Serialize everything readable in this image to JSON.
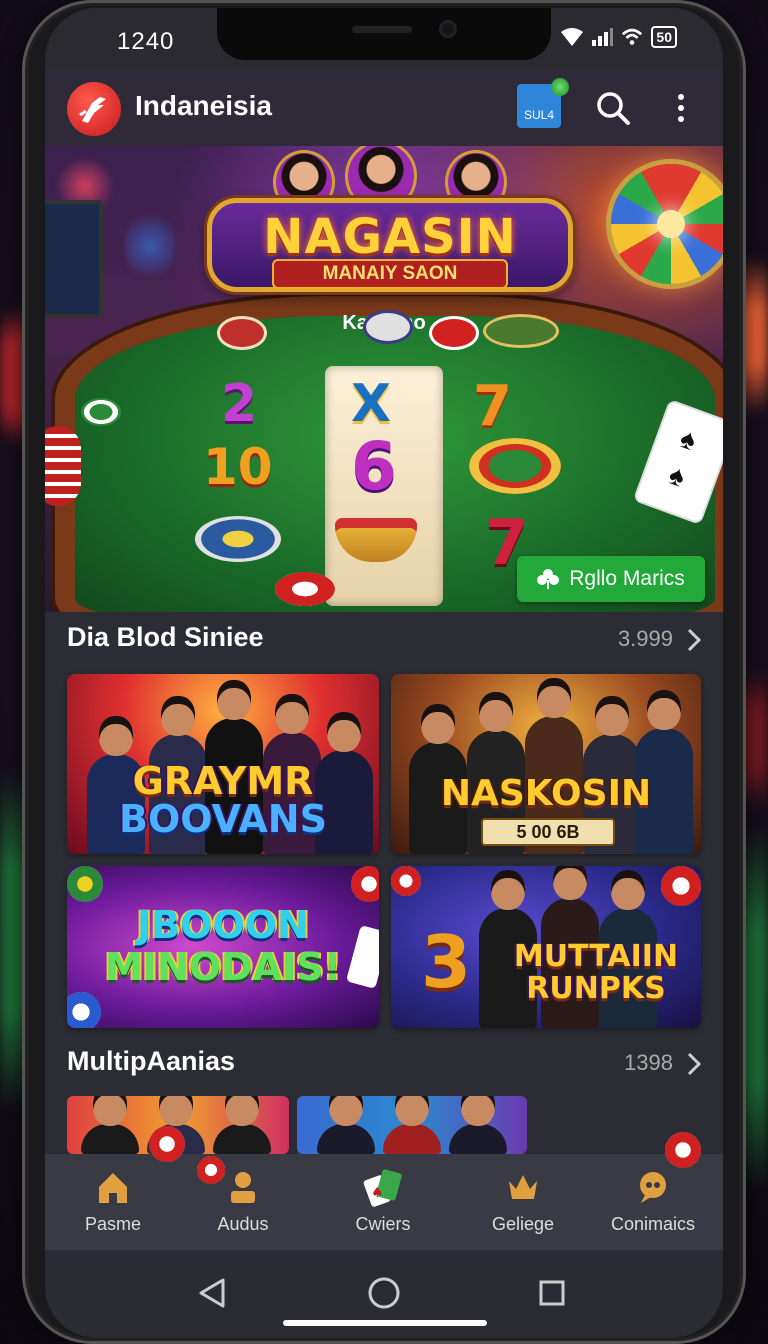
{
  "status_bar": {
    "time": "1240",
    "battery": "50"
  },
  "app_bar": {
    "title": "Indaneisia",
    "mini_game_label": "SUL4"
  },
  "hero": {
    "marquee_title": "NAGASIN",
    "marquee_subtitle": "MANAIY SAON",
    "table_label": "Ka.ssino",
    "reel_symbols": [
      "2",
      "X",
      "7",
      "10",
      "6",
      "7"
    ],
    "cta_label": "Rgllo Marics"
  },
  "section1": {
    "title": "Dia Blod Siniee",
    "count": "3.999",
    "tiles": [
      {
        "title_line1": "GRAYMR",
        "title_line2": "BOOVANS"
      },
      {
        "title_line1": "NASKOSIN",
        "subtitle": "5 00 6B"
      },
      {
        "title_line1": "JBOOON",
        "title_line2": "MINODAIS!"
      },
      {
        "big_number": "3",
        "title_line1": "MUTTAIIN",
        "title_line2": "RUNPKS"
      }
    ]
  },
  "section2": {
    "title": "MultipAanias",
    "count": "1398"
  },
  "bottom_nav": {
    "items": [
      {
        "label": "Pasme",
        "icon": "home-icon"
      },
      {
        "label": "Audus",
        "icon": "person-icon"
      },
      {
        "label": "Cwiers",
        "icon": "cards-icon"
      },
      {
        "label": "Geliege",
        "icon": "crown-icon"
      },
      {
        "label": "Conimaics",
        "icon": "chat-icon"
      }
    ]
  },
  "colors": {
    "accent_green": "#23a83a",
    "app_bar": "#2e2a38",
    "nav": "#3a3a44"
  }
}
